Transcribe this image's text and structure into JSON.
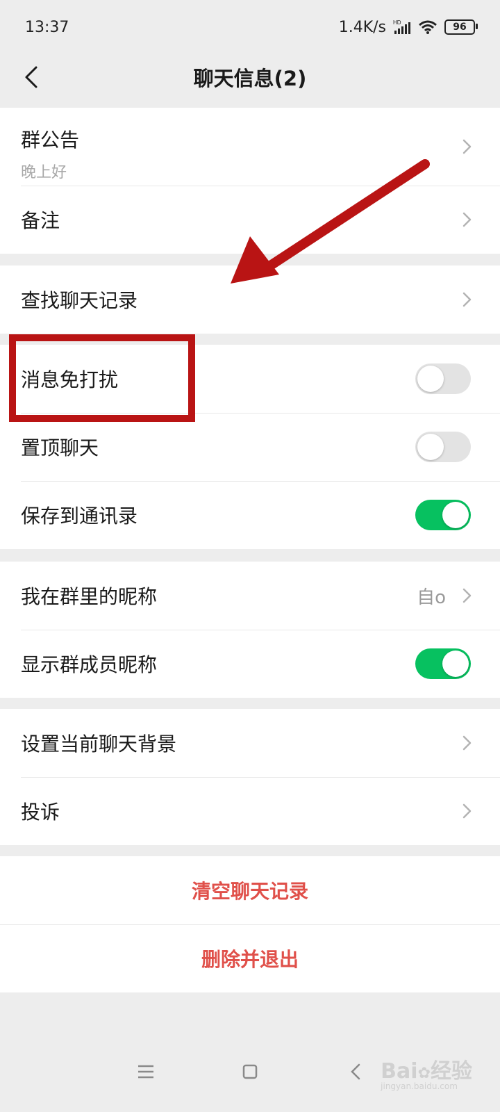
{
  "status_bar": {
    "time": "13:37",
    "speed": "1.4K/s",
    "network": "HD",
    "battery": "96"
  },
  "header": {
    "title": "聊天信息(2)"
  },
  "section1": {
    "announcement_label": "群公告",
    "announcement_text": "晚上好",
    "remark_label": "备注"
  },
  "section2": {
    "search_label": "查找聊天记录"
  },
  "section3": {
    "mute_label": "消息免打扰",
    "mute_on": false,
    "pin_label": "置顶聊天",
    "pin_on": false,
    "save_label": "保存到通讯录",
    "save_on": true
  },
  "section4": {
    "nickname_label": "我在群里的昵称",
    "nickname_value": "自o",
    "show_nicknames_label": "显示群成员昵称",
    "show_nicknames_on": true
  },
  "section5": {
    "background_label": "设置当前聊天背景",
    "complaint_label": "投诉"
  },
  "actions": {
    "clear_history": "清空聊天记录",
    "delete_exit": "删除并退出"
  },
  "colors": {
    "accent_green": "#07c160",
    "danger_red": "#e0504a",
    "annotation_red": "#b91414"
  },
  "watermark": {
    "text": "Bai",
    "text2": "经验",
    "subtext": "jingyan.baidu.com"
  },
  "icons": [
    "back-chevron-icon",
    "chevron-right-icon",
    "menu-icon",
    "home-square-icon",
    "back-triangle-icon",
    "signal-icon",
    "wifi-icon",
    "battery-icon"
  ]
}
